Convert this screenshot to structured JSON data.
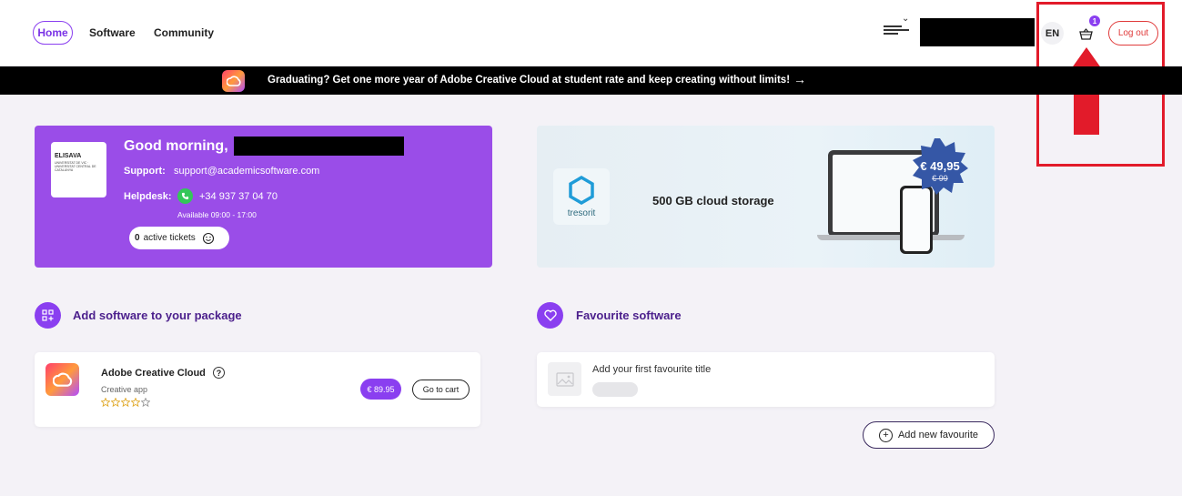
{
  "header": {
    "nav": {
      "home": "Home",
      "software": "Software",
      "community": "Community"
    },
    "language": "EN",
    "cart_count": "1",
    "logout": "Log out"
  },
  "banner": {
    "text": "Graduating? Get one more year of Adobe Creative Cloud at student rate and keep creating without limits!",
    "arrow": "→"
  },
  "welcome": {
    "greeting": "Good morning,",
    "logo_name": "ELISAVA",
    "logo_sub": "UNIVERSITAT DE VIC · UNIVERSITAT CENTRAL DE CATALUNYA",
    "support_label": "Support:",
    "support_email": "support@academicsoftware.com",
    "helpdesk_label": "Helpdesk:",
    "helpdesk_phone": "+34 937 37 04 70",
    "availability": "Available 09:00 - 17:00",
    "tickets_count": "0",
    "tickets_label": "active tickets"
  },
  "promo": {
    "brand": "tresorit",
    "headline": "500 GB cloud storage",
    "price": "€ 49,95",
    "old_price": "€ 99"
  },
  "add_software": {
    "title": "Add software to your package",
    "item": {
      "name": "Adobe Creative Cloud",
      "category": "Creative app",
      "rating": 0,
      "rating_max": 5,
      "price": "€ 89.95",
      "cta": "Go to cart"
    }
  },
  "favourites": {
    "title": "Favourite software",
    "empty_text": "Add your first favourite title",
    "add_button": "Add new favourite"
  },
  "colors": {
    "accent": "#8a3ff0",
    "welcome_bg": "#9a4de8",
    "logout": "#e03b3b",
    "annotation": "#e21b2a"
  }
}
